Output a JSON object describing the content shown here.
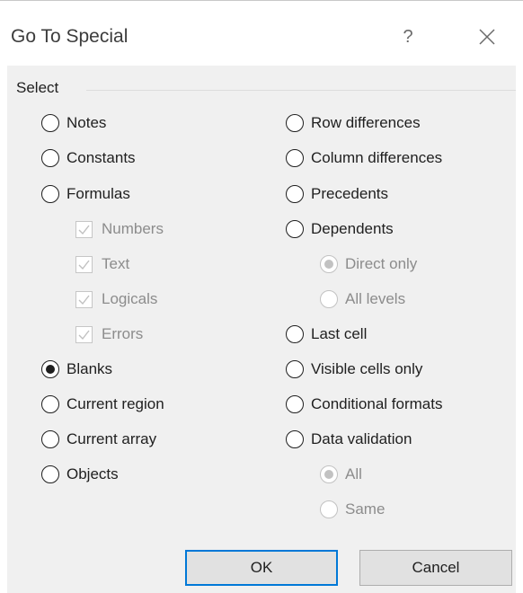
{
  "dialog": {
    "title": "Go To Special",
    "help_label": "?"
  },
  "group": {
    "label": "Select"
  },
  "left_options": [
    {
      "label": "Notes",
      "checked": false,
      "disabled": false
    },
    {
      "label": "Constants",
      "checked": false,
      "disabled": false
    },
    {
      "label": "Formulas",
      "checked": false,
      "disabled": false
    },
    {
      "label": "Numbers",
      "checked": true,
      "disabled": true
    },
    {
      "label": "Text",
      "checked": true,
      "disabled": true
    },
    {
      "label": "Logicals",
      "checked": true,
      "disabled": true
    },
    {
      "label": "Errors",
      "checked": true,
      "disabled": true
    },
    {
      "label": "Blanks",
      "checked": true,
      "disabled": false
    },
    {
      "label": "Current region",
      "checked": false,
      "disabled": false
    },
    {
      "label": "Current array",
      "checked": false,
      "disabled": false
    },
    {
      "label": "Objects",
      "checked": false,
      "disabled": false
    }
  ],
  "right_options": [
    {
      "label": "Row differences",
      "checked": false,
      "disabled": false
    },
    {
      "label": "Column differences",
      "checked": false,
      "disabled": false
    },
    {
      "label": "Precedents",
      "checked": false,
      "disabled": false
    },
    {
      "label": "Dependents",
      "checked": false,
      "disabled": false
    },
    {
      "label": "Direct only",
      "checked": true,
      "disabled": true
    },
    {
      "label": "All levels",
      "checked": false,
      "disabled": true
    },
    {
      "label": "Last cell",
      "checked": false,
      "disabled": false
    },
    {
      "label": "Visible cells only",
      "checked": false,
      "disabled": false
    },
    {
      "label": "Conditional formats",
      "checked": false,
      "disabled": false
    },
    {
      "label": "Data validation",
      "checked": false,
      "disabled": false
    },
    {
      "label": "All",
      "checked": true,
      "disabled": true
    },
    {
      "label": "Same",
      "checked": false,
      "disabled": true
    }
  ],
  "buttons": {
    "ok": "OK",
    "cancel": "Cancel"
  },
  "colors": {
    "dialog_bg": "#f0f0f0",
    "accent": "#0078d7"
  }
}
